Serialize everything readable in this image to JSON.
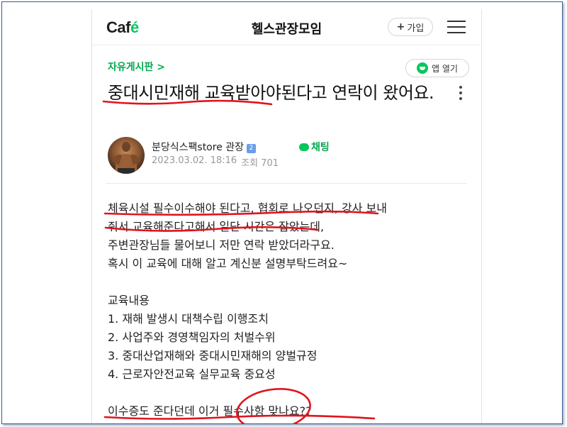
{
  "header": {
    "logo_text": "Caf",
    "logo_accent": "é",
    "cafe_name": "헬스관장모임",
    "join_label": "가입",
    "join_plus": "+"
  },
  "board": {
    "name": "자유게시판 >",
    "app_open_label": "앱 열기"
  },
  "post": {
    "title": "중대시민재해 교육받아야된다고 연락이 왔어요.",
    "author": "분당식스팩store 관장",
    "level": "2",
    "chat_label": "채팅",
    "date": "2023.03.02. 18:16",
    "views_label": "조회 701",
    "body_lines": [
      "체육시설 필수이수해야 된다고, 협회로 나오던지, 강사 보내",
      "줘서 교육해준다고해서 일단 시간은 잡았는데,",
      "주변관장님들 물어보니 저만 연락 받았더라구요.",
      "혹시 이 교육에 대해 알고 계신분 설명부탁드려요~",
      "",
      "교육내용",
      "1. 재해 발생시 대책수립 이행조치",
      "2. 사업주와 경영책임자의 처벌수위",
      "3. 중대산업재해와 중대시민재해의 양벌규정",
      "4. 근로자안전교육 실무교육 중요성",
      "",
      "이수증도 준다던데 이거 필수사항 맞나요??"
    ]
  },
  "colors": {
    "brand_green": "#03c75a",
    "annotation_red": "#e0141e"
  },
  "icons": [
    "menu-icon",
    "more-icon",
    "chat-icon",
    "app-icon"
  ]
}
